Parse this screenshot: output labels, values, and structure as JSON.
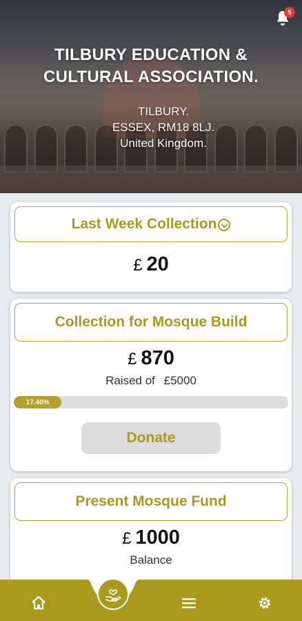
{
  "header": {
    "title": "TILBURY EDUCATION & CULTURAL ASSOCIATION.",
    "address_line1": "TILBURY.",
    "address_line2": "ESSEX, RM18 8LJ.",
    "address_line3": "United Kingdom.",
    "notification_count": "5"
  },
  "last_week": {
    "title": "Last Week Collection",
    "currency": "£",
    "amount": "20"
  },
  "mosque_build": {
    "title": "Collection for Mosque Build",
    "currency": "£",
    "amount": "870",
    "raised_label": "Raised of",
    "target_currency": "£",
    "target": "5000",
    "progress_label": "17.40%",
    "progress_percent": 17.4,
    "donate_label": "Donate"
  },
  "present_fund": {
    "title": "Present Mosque Fund",
    "currency": "£",
    "amount": "1000",
    "balance_label": "Balance"
  },
  "nav": {
    "items": [
      "home-icon",
      "donate-hand-icon",
      "menu-icon",
      "settings-icon"
    ]
  },
  "colors": {
    "accent": "#a99a1e",
    "badge": "#e53935"
  }
}
